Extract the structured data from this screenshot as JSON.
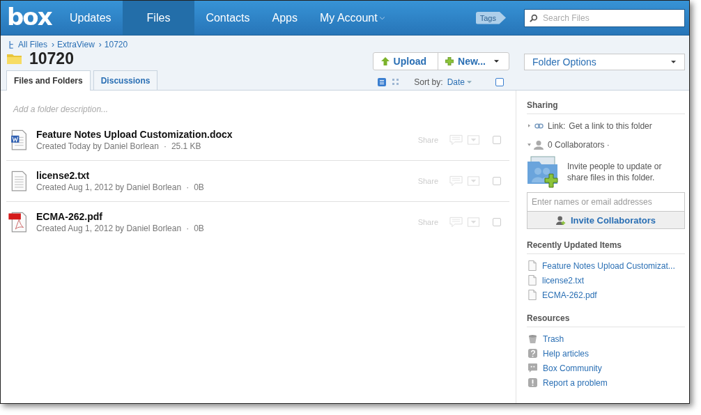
{
  "header": {
    "logo": "box",
    "nav": [
      {
        "label": "Updates",
        "selected": false,
        "dropdown": false
      },
      {
        "label": "Files",
        "selected": true,
        "dropdown": false
      },
      {
        "label": "Contacts",
        "selected": false,
        "dropdown": false
      },
      {
        "label": "Apps",
        "selected": false,
        "dropdown": false
      },
      {
        "label": "My Account",
        "selected": false,
        "dropdown": true
      }
    ],
    "tags": "Tags",
    "search": {
      "placeholder": "Search Files"
    }
  },
  "breadcrumb": {
    "items": [
      "All Files",
      "ExtraView",
      "10720"
    ],
    "separators": [
      "›",
      "›"
    ]
  },
  "folder": {
    "title": "10720"
  },
  "tabs": [
    {
      "label": "Files and Folders",
      "selected": true
    },
    {
      "label": "Discussions",
      "selected": false
    }
  ],
  "toolbar": {
    "buttons": [
      {
        "kind": "upload",
        "label": "Upload"
      },
      {
        "kind": "new",
        "label": "New..."
      }
    ],
    "views": [
      {
        "kind": "list",
        "selected": true
      },
      {
        "kind": "grid",
        "selected": false
      }
    ],
    "sort_label": "Sort by:",
    "sort_value": "Date",
    "select_all": {
      "checked": false
    }
  },
  "folder_options": {
    "label": "Folder Options"
  },
  "description_placeholder": "Add a folder description...",
  "files": [
    {
      "kind": "word",
      "name": "Feature Notes Upload Customization.docx",
      "meta": "Created Today by Daniel Borlean",
      "separator": "·",
      "size": "25.1 KB",
      "share": "Share",
      "checked": false
    },
    {
      "kind": "text",
      "name": "license2.txt",
      "meta": "Created Aug 1, 2012 by Daniel Borlean",
      "separator": "·",
      "size": "0B",
      "share": "Share",
      "checked": false
    },
    {
      "kind": "pdf",
      "name": "ECMA-262.pdf",
      "meta": "Created Aug 1, 2012 by Daniel Borlean",
      "separator": "·",
      "size": "0B",
      "share": "Share",
      "checked": false
    }
  ],
  "sidebar": {
    "sharing": {
      "title": "Sharing",
      "link_label": "Link:",
      "link_text": "Get a link to this folder",
      "collaborators": "0 Collaborators ·",
      "collaborators_expanded": true,
      "invite_text": "Invite people to update or share files in this folder.",
      "invite_placeholder": "Enter names or email addresses",
      "invite_button": "Invite Collaborators"
    },
    "recent": {
      "title": "Recently Updated Items",
      "items": [
        "Feature Notes Upload Customizat...",
        "license2.txt",
        "ECMA-262.pdf"
      ]
    },
    "resources": {
      "title": "Resources",
      "items": [
        {
          "kind": "trash",
          "label": "Trash"
        },
        {
          "kind": "help",
          "label": "Help articles"
        },
        {
          "kind": "community",
          "label": "Box Community"
        },
        {
          "kind": "report",
          "label": "Report a problem"
        }
      ]
    }
  }
}
